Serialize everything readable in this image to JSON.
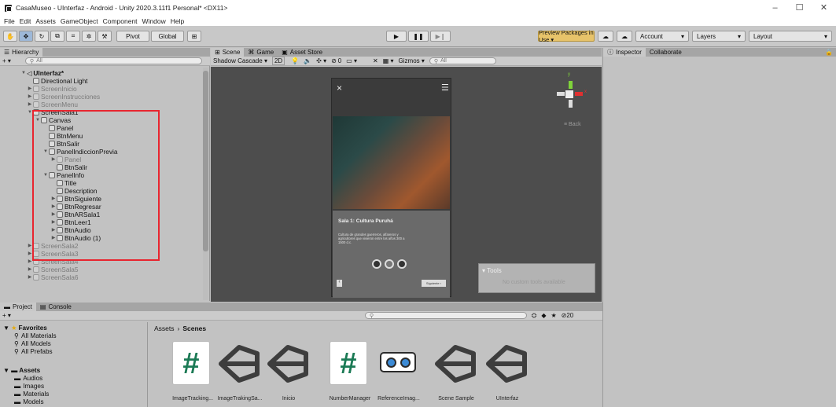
{
  "window": {
    "title": "CasaMuseo - UInterfaz - Android - Unity 2020.3.11f1 Personal* <DX11>",
    "controls": [
      "–",
      "☐",
      "✕"
    ]
  },
  "menu": [
    "File",
    "Edit",
    "Assets",
    "GameObject",
    "Component",
    "Window",
    "Help"
  ],
  "toolbar": {
    "pivot": "Pivot",
    "global": "Global",
    "preview_packages": "Preview Packages in Use ▾",
    "account": "Account",
    "layers": "Layers",
    "layout": "Layout"
  },
  "hierarchy": {
    "tab": "Hierarchy",
    "search_placeholder": "All",
    "root": "UInterfaz*",
    "items": [
      {
        "label": "Directional Light"
      },
      {
        "label": "ScreenInicio"
      },
      {
        "label": "ScreenInstrucciones"
      },
      {
        "label": "ScreenMenu"
      },
      {
        "label": "ScreenSala1"
      },
      {
        "label": "Canvas"
      },
      {
        "label": "Panel"
      },
      {
        "label": "BtnMenu"
      },
      {
        "label": "BtnSalir"
      },
      {
        "label": "PanelIndiccionPrevia"
      },
      {
        "label": "Panel"
      },
      {
        "label": "BtnSalir"
      },
      {
        "label": "PanelInfo"
      },
      {
        "label": "Title"
      },
      {
        "label": "Description"
      },
      {
        "label": "BtnSiguiente"
      },
      {
        "label": "BtnRegresar"
      },
      {
        "label": "BtnARSala1"
      },
      {
        "label": "BtnLeer1"
      },
      {
        "label": "BtnAudio"
      },
      {
        "label": "BtnAudio (1)"
      },
      {
        "label": "ScreenSala2"
      },
      {
        "label": "ScreenSala3"
      },
      {
        "label": "ScreenSala4"
      },
      {
        "label": "ScreenSala5"
      },
      {
        "label": "ScreenSala6"
      }
    ]
  },
  "scene": {
    "tabs": [
      "Scene",
      "Game",
      "Asset Store"
    ],
    "shading": "Shadow Cascade",
    "mode_2d": "2D",
    "gizmos": "Gizmos",
    "search_placeholder": "All",
    "hidden_count": "0",
    "gizmo_back": "Back",
    "gizmo_y": "y",
    "gizmo_x": "x",
    "tools_title": "Tools",
    "tools_msg": "No custom tools available"
  },
  "device_ui": {
    "title": "Sala 1: Cultura Puruhá",
    "description": "Cultura de grandes guerreros, alfareros y agricultores que vivieron entre los años 300 a 1500 d.c.",
    "next": "Siguiente"
  },
  "inspector": {
    "tabs": [
      "Inspector",
      "Collaborate"
    ]
  },
  "project": {
    "tabs": [
      "Project",
      "Console"
    ],
    "hidden_count": "20",
    "favorites_label": "Favorites",
    "favorites": [
      "All Materials",
      "All Models",
      "All Prefabs"
    ],
    "assets_label": "Assets",
    "folders": [
      "Audios",
      "Images",
      "Materials",
      "Models"
    ],
    "breadcrumb": [
      "Assets",
      "Scenes"
    ],
    "assets": [
      {
        "label": "ImageTracking...",
        "icon": "script-icon"
      },
      {
        "label": "ImageTrakingSa...",
        "icon": "unity-scene-icon"
      },
      {
        "label": "Inicio",
        "icon": "unity-scene-icon"
      },
      {
        "label": "NumberManager",
        "icon": "script-icon"
      },
      {
        "label": "ReferenceImag...",
        "icon": "reference-image-icon"
      },
      {
        "label": "Scene Sample",
        "icon": "unity-scene-icon"
      },
      {
        "label": "UInterfaz",
        "icon": "unity-scene-icon"
      }
    ]
  }
}
